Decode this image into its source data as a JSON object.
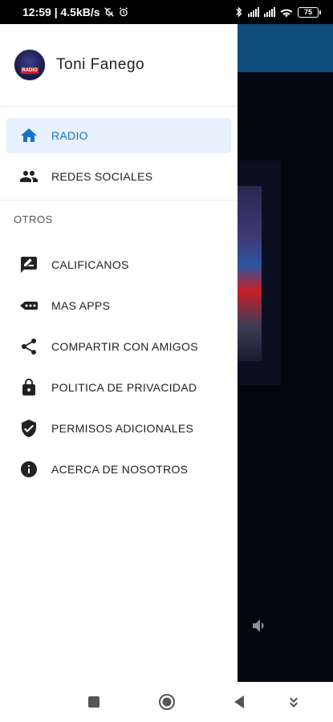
{
  "status_bar": {
    "time_speed": "12:59 | 4.5kB/s",
    "battery": "75"
  },
  "drawer": {
    "user_name": "Toni Fanego",
    "avatar_badge": "RADIO",
    "main_items": [
      {
        "label": "RADIO",
        "icon": "home-icon",
        "active": true
      },
      {
        "label": "REDES SOCIALES",
        "icon": "people-icon",
        "active": false
      }
    ],
    "section_title": "OTROS",
    "other_items": [
      {
        "label": "CALIFICANOS",
        "icon": "rate-review-icon"
      },
      {
        "label": "MAS APPS",
        "icon": "more-apps-icon"
      },
      {
        "label": "COMPARTIR CON AMIGOS",
        "icon": "share-icon"
      },
      {
        "label": "POLITICA DE PRIVACIDAD",
        "icon": "lock-icon"
      },
      {
        "label": "PERMISOS ADICIONALES",
        "icon": "shield-check-icon"
      },
      {
        "label": "ACERCA DE NOSOTROS",
        "icon": "info-icon"
      }
    ]
  },
  "colors": {
    "accent": "#1a73c8",
    "active_bg": "#e6f1fb",
    "toolbar": "#0f4d7d"
  }
}
